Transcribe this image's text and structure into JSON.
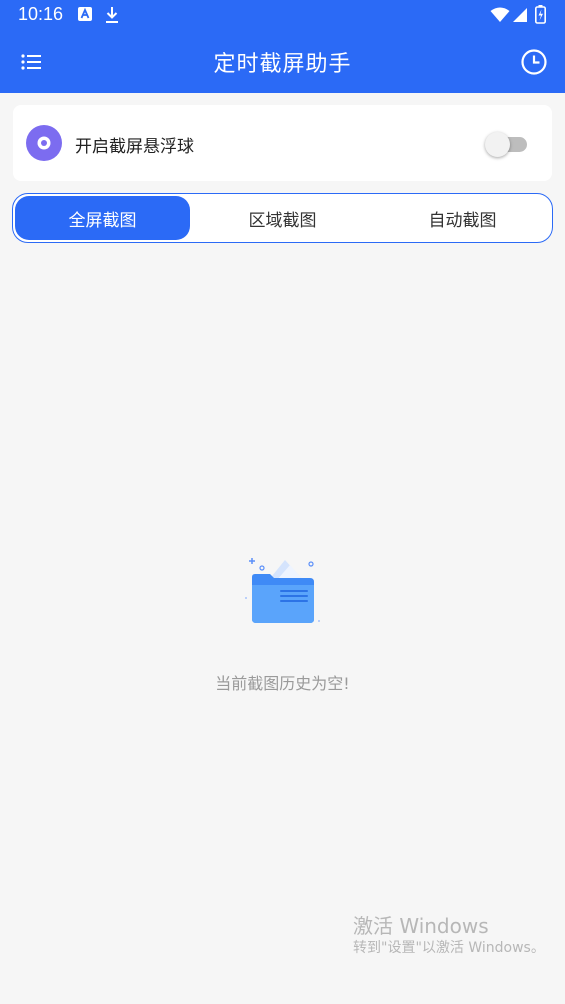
{
  "status_bar": {
    "time": "10:16",
    "icons": [
      "text-a-icon",
      "download-icon",
      "wifi-icon",
      "signal-icon",
      "battery-charging-icon"
    ]
  },
  "app_bar": {
    "title": "定时截屏助手",
    "left_icon": "menu-list-icon",
    "right_icon": "clock-history-icon"
  },
  "floating_ball": {
    "label": "开启截屏悬浮球",
    "icon": "record-disc-icon",
    "icon_color": "#7c6cf0",
    "enabled": false
  },
  "tabs": [
    {
      "label": "全屏截图",
      "active": true
    },
    {
      "label": "区域截图",
      "active": false
    },
    {
      "label": "自动截图",
      "active": false
    }
  ],
  "empty_state": {
    "icon": "empty-folder-icon",
    "message": "当前截图历史为空!"
  },
  "watermark": {
    "line1": "激活 Windows",
    "line2": "转到\"设置\"以激活 Windows。"
  },
  "colors": {
    "primary": "#2b6af6",
    "background": "#f6f6f6",
    "card": "#ffffff"
  }
}
